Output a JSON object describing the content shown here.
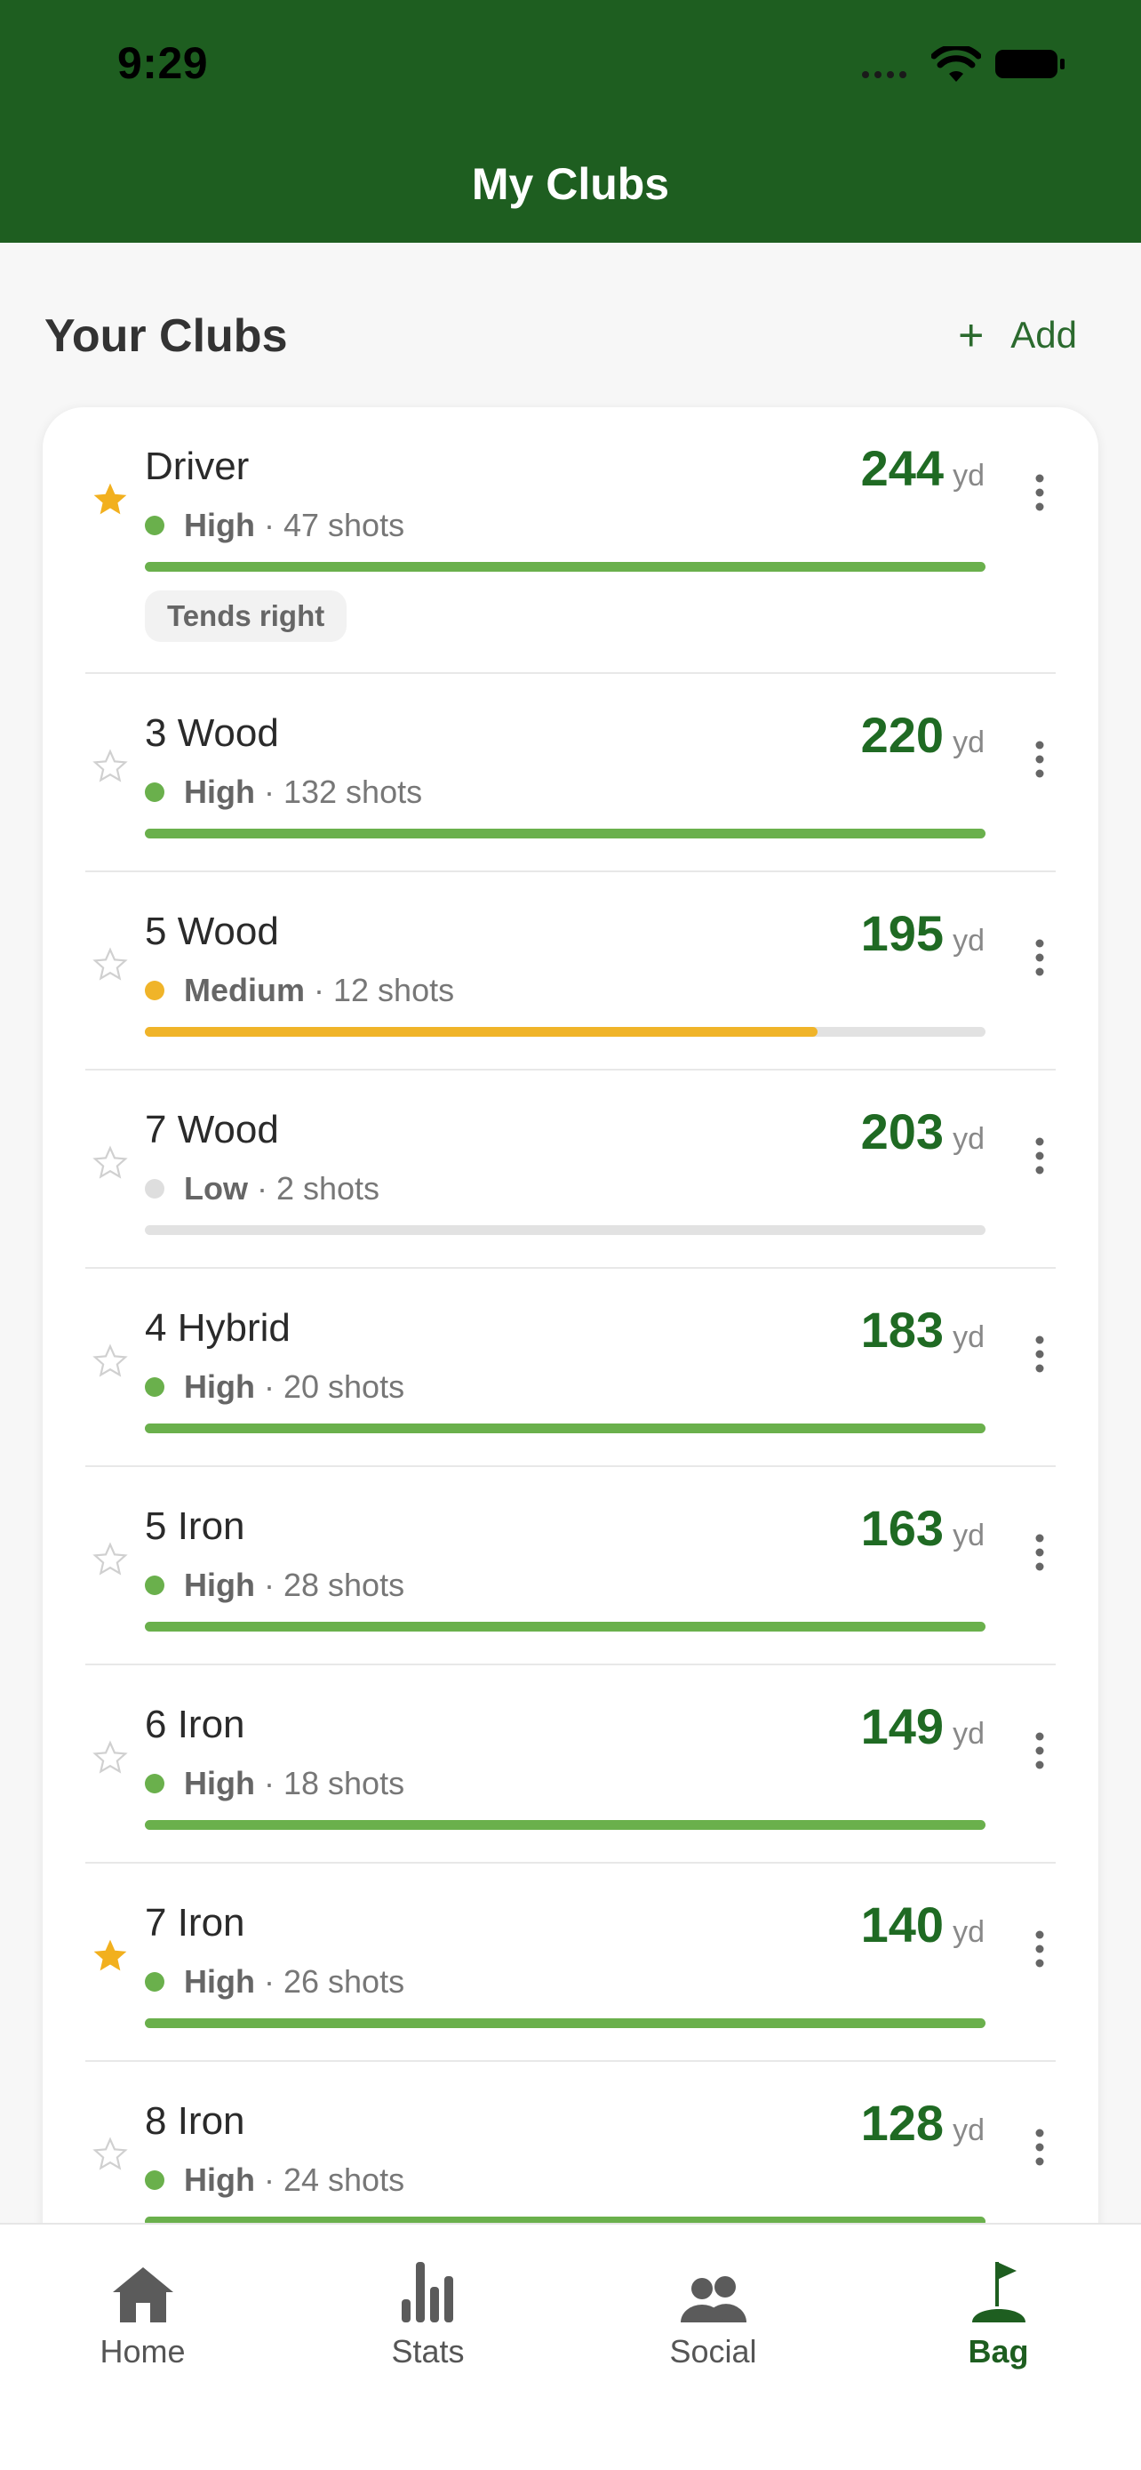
{
  "status_bar": {
    "time": "9:29"
  },
  "header": {
    "title": "My Clubs"
  },
  "section": {
    "title": "Your Clubs",
    "add_label": "Add"
  },
  "colors": {
    "header_bg": "#1e5e20",
    "accent": "#1f6a23",
    "high": "#6ab04c",
    "medium": "#f0b429",
    "low": "#dedede",
    "star_active": "#f2b01e"
  },
  "clubs": [
    {
      "name": "Driver",
      "favorite": true,
      "confidence": "High",
      "shots": "· 47 shots",
      "distance": "244",
      "unit": "yd",
      "progress": 1.0,
      "tag": "Tends right"
    },
    {
      "name": "3 Wood",
      "favorite": false,
      "confidence": "High",
      "shots": "· 132 shots",
      "distance": "220",
      "unit": "yd",
      "progress": 1.0
    },
    {
      "name": "5 Wood",
      "favorite": false,
      "confidence": "Medium",
      "shots": "· 12 shots",
      "distance": "195",
      "unit": "yd",
      "progress": 0.8
    },
    {
      "name": "7 Wood",
      "favorite": false,
      "confidence": "Low",
      "shots": "· 2 shots",
      "distance": "203",
      "unit": "yd",
      "progress": 0.0
    },
    {
      "name": "4 Hybrid",
      "favorite": false,
      "confidence": "High",
      "shots": "· 20 shots",
      "distance": "183",
      "unit": "yd",
      "progress": 1.0
    },
    {
      "name": "5 Iron",
      "favorite": false,
      "confidence": "High",
      "shots": "· 28 shots",
      "distance": "163",
      "unit": "yd",
      "progress": 1.0
    },
    {
      "name": "6 Iron",
      "favorite": false,
      "confidence": "High",
      "shots": "· 18 shots",
      "distance": "149",
      "unit": "yd",
      "progress": 1.0
    },
    {
      "name": "7 Iron",
      "favorite": true,
      "confidence": "High",
      "shots": "· 26 shots",
      "distance": "140",
      "unit": "yd",
      "progress": 1.0
    },
    {
      "name": "8 Iron",
      "favorite": false,
      "confidence": "High",
      "shots": "· 24 shots",
      "distance": "128",
      "unit": "yd",
      "progress": 1.0
    }
  ],
  "tabs": [
    {
      "label": "Home",
      "icon": "home-icon",
      "active": false
    },
    {
      "label": "Stats",
      "icon": "stats-icon",
      "active": false
    },
    {
      "label": "Social",
      "icon": "social-icon",
      "active": false
    },
    {
      "label": "Bag",
      "icon": "flag-icon",
      "active": true
    }
  ]
}
